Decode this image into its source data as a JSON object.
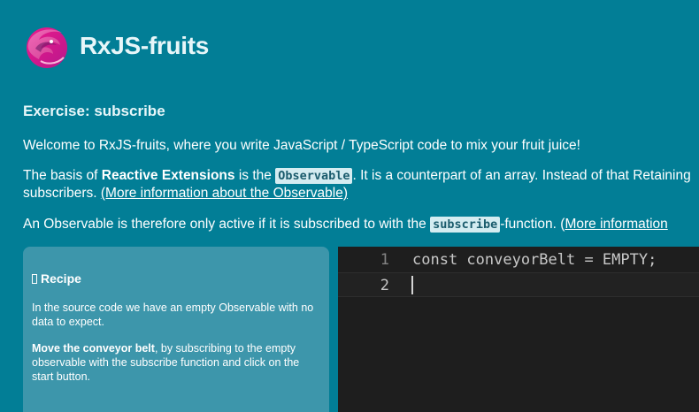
{
  "app": {
    "title": "RxJS-fruits"
  },
  "exercise": {
    "title": "Exercise: subscribe",
    "intro": "Welcome to RxJS-fruits, where you write JavaScript / TypeScript code to mix your fruit juice!",
    "basis_prefix": "The basis of ",
    "basis_bold": "Reactive Extensions",
    "basis_mid": " is the ",
    "basis_code": "Observable",
    "basis_suffix": ". It is a counterpart of an array. Instead of that Retaining",
    "basis_line2": "subscribers. ",
    "basis_link": "(More information about the Observable)",
    "active_prefix": "An Observable is therefore only active if it is subscribed to with the ",
    "active_code": "subscribe",
    "active_suffix": "-function. (",
    "active_link": "More information"
  },
  "recipe": {
    "title": "Recipe",
    "text1": "In the source code we have an empty Observable with no data to expect.",
    "text2_bold": "Move the conveyor belt",
    "text2_rest": ", by subscribing to the empty observable with the subscribe function and click on the start button."
  },
  "editor": {
    "lines": [
      {
        "number": "1",
        "code": "const conveyorBelt = EMPTY;"
      },
      {
        "number": "2",
        "code": ""
      }
    ],
    "current_line": 2
  },
  "colors": {
    "background": "#027e96",
    "recipe_panel": "#3d96ab",
    "editor_background": "#1e1e1e",
    "code_highlight": "#d4ecf1",
    "logo_primary": "#e0247a"
  },
  "icons": {
    "logo": "rxjs-logo-icon",
    "recipe": "box-icon"
  }
}
